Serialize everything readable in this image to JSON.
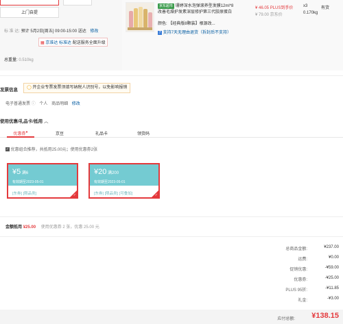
{
  "delivery": {
    "pickup_button": "上门自提",
    "schedule_label": "标 准 达:",
    "schedule_text": "预计 5月2日[周五] 09:00-15:00 送达",
    "modify": "修改",
    "service_tag": "京准达",
    "service_standard": "标准达",
    "service_note": "配送服务全面升级",
    "weight_label": "总重量:",
    "weight_value": "0.510kg"
  },
  "product": {
    "badge": "京东超市",
    "title_line1": "珊婷深水泡弹滚养型发膜12ml*8",
    "title_line2": "改善毛燥护发素深层修护第三代胶原蛋白",
    "color_label": "颜色:",
    "color_value": "【经典版8颗装】根源改...",
    "return_note": "支持7天无理由退货（拆封后不支持）",
    "price": "¥ 46.05",
    "plus_label": "PLUS到手价",
    "orig_price": "¥ 79.00 京东价",
    "qty": "x3",
    "stock": "有货",
    "weight": "0.170kg"
  },
  "invoice": {
    "title": "发票信息",
    "notice": "开企业专票发票须填写纳税人识别号，以免影响报销",
    "type": "电子普通发票",
    "to": "个人",
    "detail": "商品明细",
    "modify": "修改"
  },
  "coupon_section": {
    "title": "使用优惠/礼品卡/抵用",
    "tabs": [
      {
        "label": "优惠券"
      },
      {
        "label": "京豆"
      },
      {
        "label": "礼品卡"
      },
      {
        "label": "领货码"
      }
    ],
    "combo_text": "优惠组合推荐，共抵用25.00元；使用优惠券2张",
    "coupons": [
      {
        "amount": "¥5",
        "cond": "满6",
        "expire": "有效期至2023-05-01",
        "tags": "[东券] [限品类]"
      },
      {
        "amount": "¥20",
        "cond": "满200",
        "expire": "有效期至2023-05-01",
        "tags": "[东券] [限品类] [可叠加]"
      }
    ],
    "deduct_label": "金额抵用",
    "deduct_amount": "¥25.00",
    "deduct_note": "使用优惠券 2 张，优惠 25.00 元"
  },
  "summary": {
    "rows": [
      {
        "label": "总商品金额:",
        "value": "¥237.00"
      },
      {
        "label": "运费:",
        "value": "¥0.00"
      },
      {
        "label": "促销优惠:",
        "value": "-¥59.00"
      },
      {
        "label": "优惠券:",
        "value": "-¥25.00"
      },
      {
        "label": "PLUS 95折:",
        "value": "-¥11.85"
      },
      {
        "label": "礼金:",
        "value": "-¥3.00"
      }
    ],
    "payable_label": "应付总额:",
    "payable_value": "¥138.15"
  },
  "colors": {
    "accent": "#e4393c",
    "coupon_teal": "#74cbd2",
    "link_blue": "#005aa0",
    "jd_green": "#3c9c4d"
  }
}
